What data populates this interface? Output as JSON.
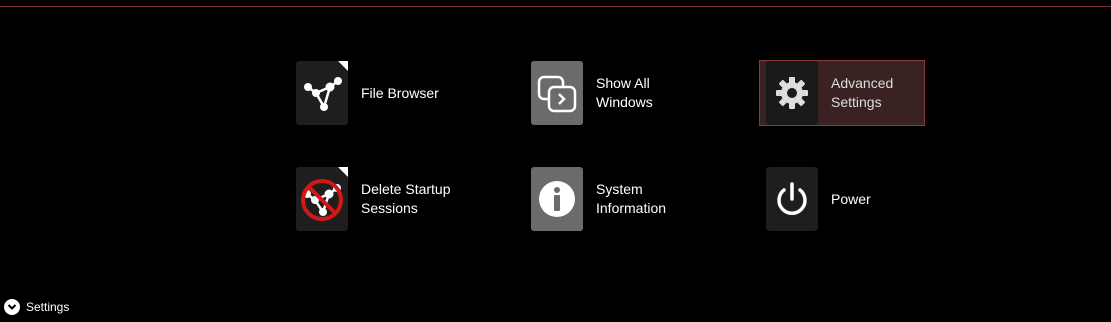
{
  "menu": {
    "tiles": [
      {
        "label": "File Browser",
        "icon": "file-browser-icon"
      },
      {
        "label": "Show All\nWindows",
        "icon": "windows-icon"
      },
      {
        "label": "Advanced\nSettings",
        "icon": "gear-icon",
        "selected": true
      },
      {
        "label": "Delete Startup\nSessions",
        "icon": "delete-sessions-icon"
      },
      {
        "label": "System\nInformation",
        "icon": "info-icon"
      },
      {
        "label": "Power",
        "icon": "power-icon"
      }
    ]
  },
  "footer": {
    "settings_label": "Settings",
    "icon": "chevron-down-icon"
  },
  "colors": {
    "background": "#000000",
    "accent_line": "#7a2f2f",
    "selected_bg": "#3a2222",
    "selected_border": "#8a3a3a"
  }
}
